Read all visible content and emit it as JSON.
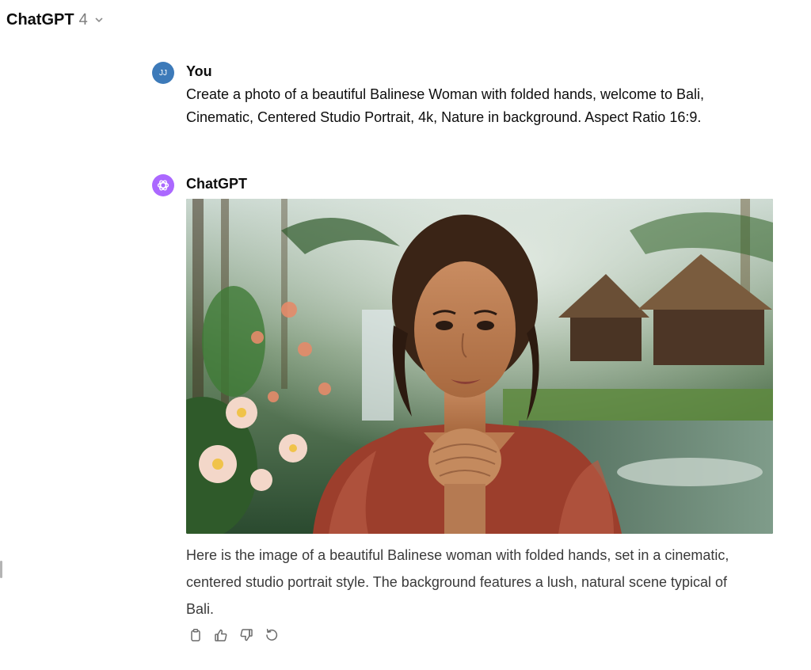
{
  "header": {
    "model_name": "ChatGPT",
    "model_version": "4",
    "dropdown_icon": "chevron-down-icon"
  },
  "user_message": {
    "avatar_initials": "JJ",
    "author": "You",
    "lines": [
      "Create a photo of a beautiful Balinese Woman with folded hands, welcome to Bali,",
      "Cinematic, Centered Studio Portrait, 4k, Nature in background. Aspect Ratio 16:9."
    ]
  },
  "assistant_message": {
    "avatar_icon": "openai-logo-icon",
    "author": "ChatGPT",
    "image_icon": "generated-portrait-image",
    "lines": [
      "Here is the image of a beautiful Balinese woman with folded hands, set in a cinematic,",
      "centered studio portrait style. The background features a lush, natural scene typical of",
      "Bali."
    ],
    "actions": [
      "copy-icon",
      "thumbs-up-icon",
      "thumbs-down-icon",
      "regenerate-icon"
    ]
  },
  "colors": {
    "user_avatar": "#3d7ab9",
    "assistant_avatar": "#ab68ff",
    "text": "#0d0d0d"
  }
}
